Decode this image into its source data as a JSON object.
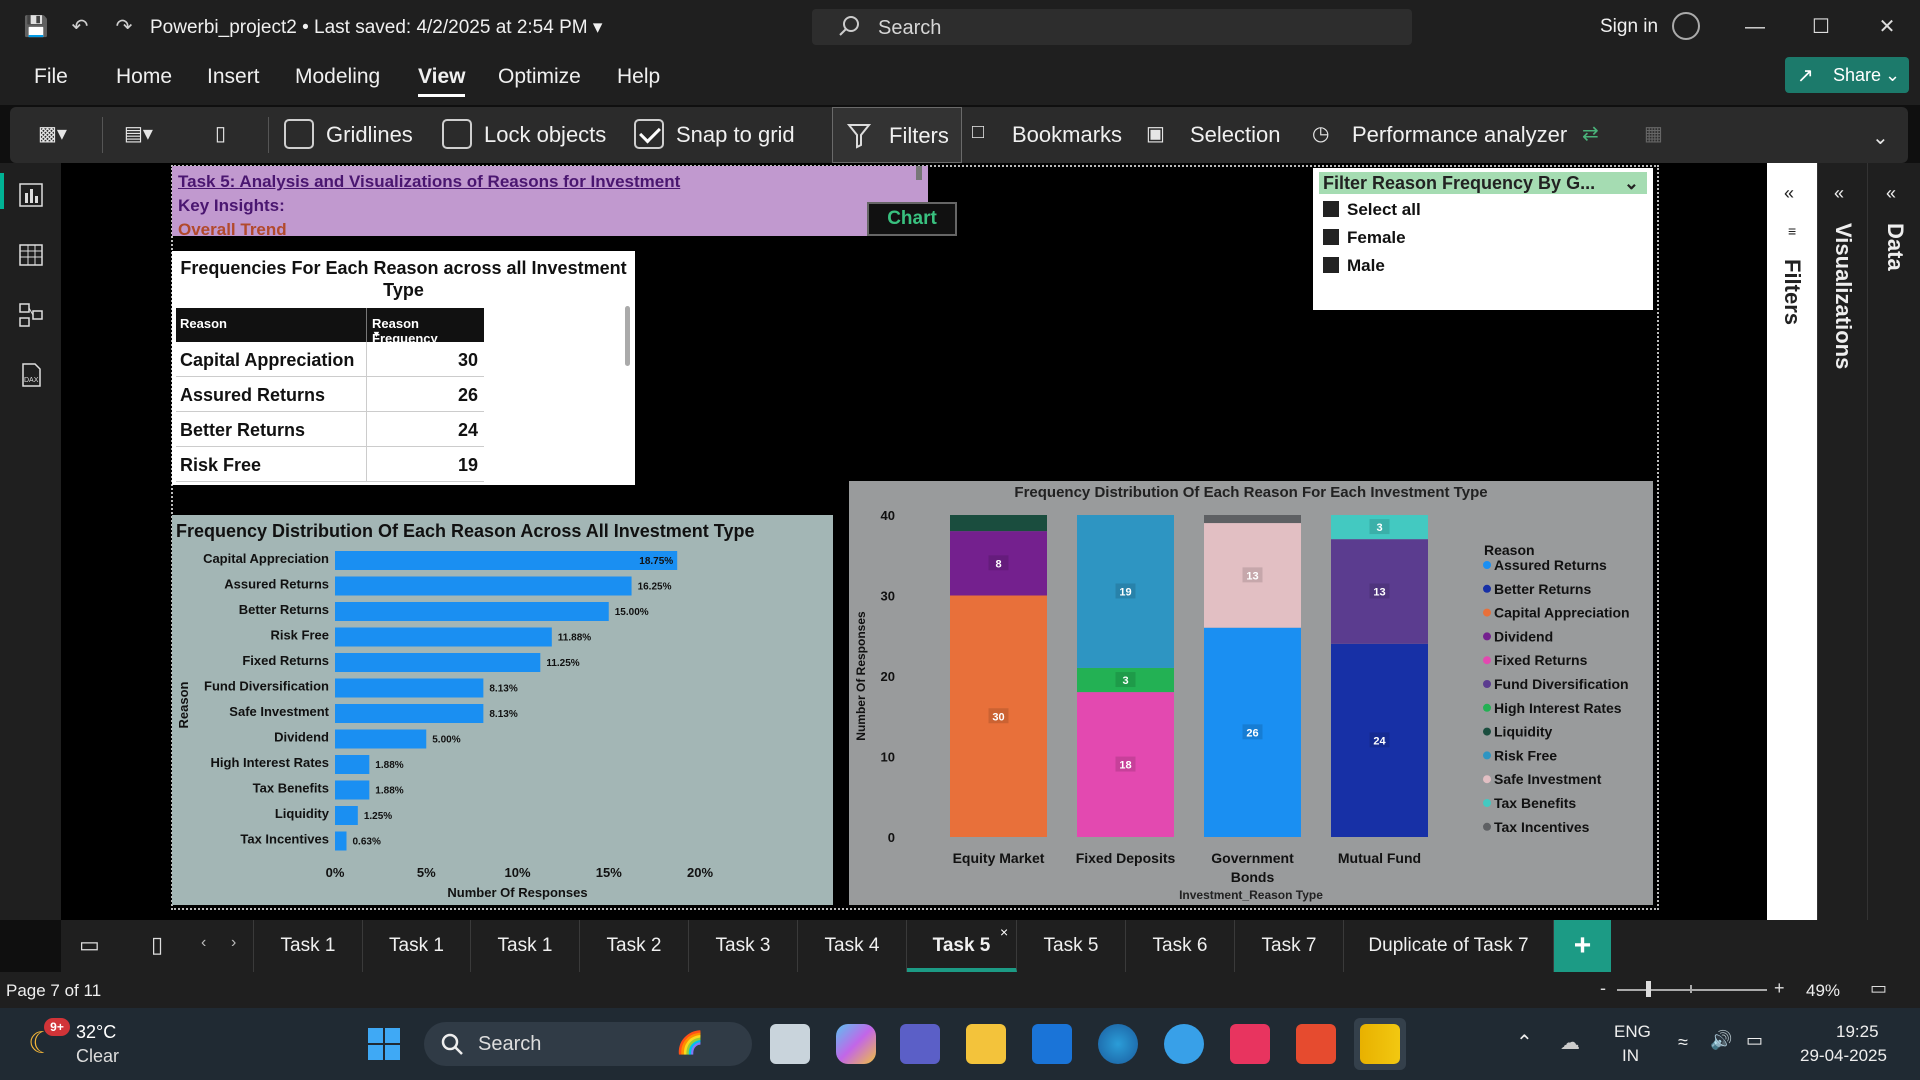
{
  "titlebar": {
    "doc_title": "Powerbi_project2 • Last saved: 4/2/2025 at 2:54 PM",
    "search_label": "Search",
    "signin_label": "Sign in"
  },
  "menu": {
    "items": [
      "File",
      "Home",
      "Insert",
      "Modeling",
      "View",
      "Optimize",
      "Help"
    ],
    "active": "View",
    "share_label": "Share"
  },
  "ribbon": {
    "gridlines_label": "Gridlines",
    "gridlines_checked": false,
    "lock_label": "Lock objects",
    "lock_checked": false,
    "snap_label": "Snap to grid",
    "snap_checked": true,
    "filters_label": "Filters",
    "bookmarks_label": "Bookmarks",
    "selection_label": "Selection",
    "perf_label": "Performance analyzer"
  },
  "task_box": {
    "title": "Task 5: Analysis and Visualizations of Reasons for Investment",
    "subtitle": "Key Insights:",
    "line3": "Overall Trend"
  },
  "chart_button": "Chart",
  "freq_table": {
    "title": "Frequencies For Each Reason across all Investment Type",
    "col1": "Reason",
    "col2": "Reason Frequency",
    "rows": [
      {
        "reason": "Capital Appreciation",
        "value": "30"
      },
      {
        "reason": "Assured Returns",
        "value": "26"
      },
      {
        "reason": "Better Returns",
        "value": "24"
      },
      {
        "reason": "Risk Free",
        "value": "19"
      }
    ]
  },
  "slicer": {
    "title": "Filter Reason Frequency By G...",
    "items": [
      "Select all",
      "Female",
      "Male"
    ]
  },
  "chart_data": [
    {
      "type": "bar",
      "orientation": "horizontal",
      "title": "Frequency Distribution Of Each Reason Across All Investment Type",
      "xlabel": "Number Of Responses",
      "ylabel": "Reason",
      "xlim": [
        0,
        20
      ],
      "x_ticks": [
        "0%",
        "5%",
        "10%",
        "15%",
        "20%"
      ],
      "categories": [
        "Capital Appreciation",
        "Assured Returns",
        "Better Returns",
        "Risk Free",
        "Fixed Returns",
        "Fund Diversification",
        "Safe Investment",
        "Dividend",
        "High Interest Rates",
        "Tax Benefits",
        "Liquidity",
        "Tax Incentives"
      ],
      "values": [
        18.75,
        16.25,
        15.0,
        11.88,
        11.25,
        8.13,
        8.13,
        5.0,
        1.88,
        1.88,
        1.25,
        0.63
      ],
      "labels": [
        "18.75%",
        "16.25%",
        "15.00%",
        "11.88%",
        "11.25%",
        "8.13%",
        "8.13%",
        "5.00%",
        "1.88%",
        "1.88%",
        "1.25%",
        "0.63%"
      ],
      "color": "#1a8ff2"
    },
    {
      "type": "bar",
      "stacked": true,
      "title": "Frequency Distribution Of Each Reason For Each Investment Type",
      "xlabel": "Investment_Reason Type",
      "ylabel": "Number Of Responses",
      "ylim": [
        0,
        40
      ],
      "y_ticks": [
        "0",
        "10",
        "20",
        "30",
        "40"
      ],
      "categories": [
        "Equity Market",
        "Fixed Deposits",
        "Government Bonds",
        "Mutual Fund"
      ],
      "x_labels": [
        [
          "Equity Market"
        ],
        [
          "Fixed Deposits"
        ],
        [
          "Government",
          "Bonds"
        ],
        [
          "Mutual Fund"
        ]
      ],
      "series": [
        {
          "name": "Capital Appreciation",
          "color": "#e8703a",
          "values": [
            30,
            0,
            0,
            0
          ],
          "labels": [
            "30",
            "",
            "",
            ""
          ]
        },
        {
          "name": "Dividend",
          "color": "#74208e",
          "values": [
            8,
            0,
            0,
            0
          ],
          "labels": [
            "8",
            "",
            "",
            ""
          ]
        },
        {
          "name": "Liquidity",
          "color": "#1a4d3e",
          "values": [
            2,
            0,
            0,
            0
          ],
          "labels": [
            "",
            "",
            "",
            ""
          ]
        },
        {
          "name": "Fixed Returns",
          "color": "#e349b0",
          "values": [
            0,
            18,
            0,
            0
          ],
          "labels": [
            "",
            "18",
            "",
            ""
          ]
        },
        {
          "name": "High Interest Rates",
          "color": "#23b154",
          "values": [
            0,
            3,
            0,
            0
          ],
          "labels": [
            "",
            "3",
            "",
            ""
          ]
        },
        {
          "name": "Risk Free",
          "color": "#2e95c2",
          "values": [
            0,
            19,
            0,
            0
          ],
          "labels": [
            "",
            "19",
            "",
            ""
          ]
        },
        {
          "name": "Assured Returns",
          "color": "#1a8ff2",
          "values": [
            0,
            0,
            26,
            0
          ],
          "labels": [
            "",
            "",
            "26",
            ""
          ]
        },
        {
          "name": "Safe Investment",
          "color": "#e2bfc3",
          "values": [
            0,
            0,
            13,
            0
          ],
          "labels": [
            "",
            "",
            "13",
            ""
          ]
        },
        {
          "name": "Tax Incentives",
          "color": "#5e6063",
          "values": [
            0,
            0,
            1,
            0
          ],
          "labels": [
            "",
            "",
            "",
            ""
          ]
        },
        {
          "name": "Better Returns",
          "color": "#1730a6",
          "values": [
            0,
            0,
            0,
            24
          ],
          "labels": [
            "",
            "",
            "",
            "24"
          ]
        },
        {
          "name": "Fund Diversification",
          "color": "#5b3c8f",
          "values": [
            0,
            0,
            0,
            13
          ],
          "labels": [
            "",
            "",
            "",
            "13"
          ]
        },
        {
          "name": "Tax Benefits",
          "color": "#43c9c1",
          "values": [
            0,
            0,
            0,
            3
          ],
          "labels": [
            "",
            "",
            "",
            "3"
          ]
        }
      ],
      "legend": {
        "title": "Reason",
        "placement": "right",
        "order": [
          "Assured Returns",
          "Better Returns",
          "Capital Appreciation",
          "Dividend",
          "Fixed Returns",
          "Fund Diversification",
          "High Interest Rates",
          "Liquidity",
          "Risk Free",
          "Safe Investment",
          "Tax Benefits",
          "Tax Incentives"
        ]
      }
    }
  ],
  "panes": {
    "filters": "Filters",
    "visualizations": "Visualizations",
    "data": "Data"
  },
  "page_tabs": {
    "tabs": [
      "Task 1",
      "Task 1",
      "Task 1",
      "Task 2",
      "Task 3",
      "Task 4",
      "Task 5",
      "Task 5",
      "Task 6",
      "Task 7",
      "Duplicate of Task 7"
    ],
    "active_index": 6,
    "add_label": "+"
  },
  "status": {
    "page": "Page 7 of 11",
    "zoom": "49%"
  },
  "taskbar": {
    "temp": "32°C",
    "weather": "Clear",
    "badge": "9+",
    "search": "Search",
    "lang1": "ENG",
    "lang2": "IN",
    "time": "19:25",
    "date": "29-04-2025"
  }
}
